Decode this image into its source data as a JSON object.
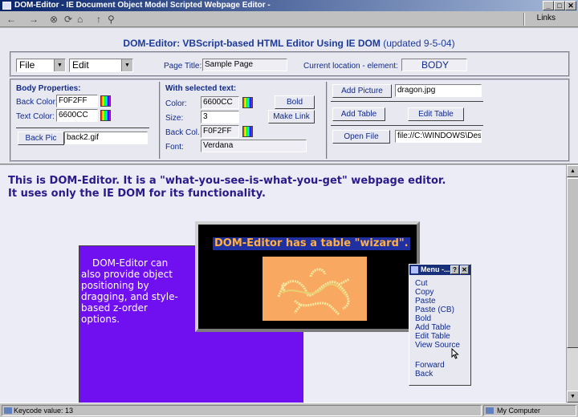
{
  "window": {
    "title": "DOM-Editor - IE Document Object Model Scripted Webpage Editor -",
    "links_label": "Links",
    "min_glyph": "_",
    "max_glyph": "□",
    "close_glyph": "✕"
  },
  "toolbar": {
    "back_glyph": "←",
    "forward_glyph": "→",
    "stop_glyph": "⊗",
    "refresh_glyph": "⟳",
    "home_glyph": "⌂",
    "pin_glyph": "↑",
    "search_glyph": "⚲"
  },
  "header": {
    "title": "DOM-Editor: VBScript-based HTML Editor Using IE DOM",
    "updated": "(updated 9-5-04)"
  },
  "menus": {
    "file_label": "File",
    "edit_label": "Edit",
    "page_title_label": "Page Title:",
    "page_title_value": "Sample Page",
    "location_label": "Current location - element:",
    "location_value": "BODY"
  },
  "body_props": {
    "heading": "Body Properties:",
    "back_color_label": "Back Color:",
    "back_color_value": "F0F2FF",
    "text_color_label": "Text Color:",
    "text_color_value": "6600CC",
    "back_pic_button": "Back Pic",
    "back_pic_value": "back2.gif"
  },
  "selected_text": {
    "heading": "With selected text:",
    "color_label": "Color:",
    "color_value": "6600CC",
    "size_label": "Size:",
    "size_value": "3",
    "back_col_label": "Back Col.",
    "back_col_value": "F0F2FF",
    "font_label": "Font:",
    "font_value": "Verdana",
    "bold_button": "Bold",
    "make_link_button": "Make Link"
  },
  "insert": {
    "add_picture_button": "Add Picture",
    "picture_value": "dragon.jpg",
    "add_table_button": "Add Table",
    "edit_table_button": "Edit Table",
    "open_file_button": "Open File",
    "file_path_value": "file://C:\\WINDOWS\\Desk"
  },
  "content": {
    "intro_line1": "This is DOM-Editor. It is a \"what-you-see-is-what-you-get\" webpage editor.",
    "intro_line2": "It uses only the IE DOM for its functionality.",
    "positioned_text": "DOM-Editor can also provide object positioning by dragging, and style-based z-order options.",
    "table_caption": "DOM-Editor has a table \"wizard\"."
  },
  "context_menu": {
    "title": "Menu -...",
    "help_glyph": "?",
    "close_glyph": "✕",
    "items": [
      "Cut",
      "Copy",
      "Paste",
      "Paste (CB)",
      "Bold",
      "Add Table",
      "Edit Table",
      "View Source",
      "Forward",
      "Back"
    ]
  },
  "status": {
    "left_text": "Keycode value: 13",
    "zone_text": "My Computer"
  },
  "colors": {
    "accent_blue": "#1c3a9a",
    "positioned_box": "#7010f0",
    "table_bg": "#000000",
    "caption_text": "#ffb040",
    "dragon_bg": "#f8a860"
  }
}
